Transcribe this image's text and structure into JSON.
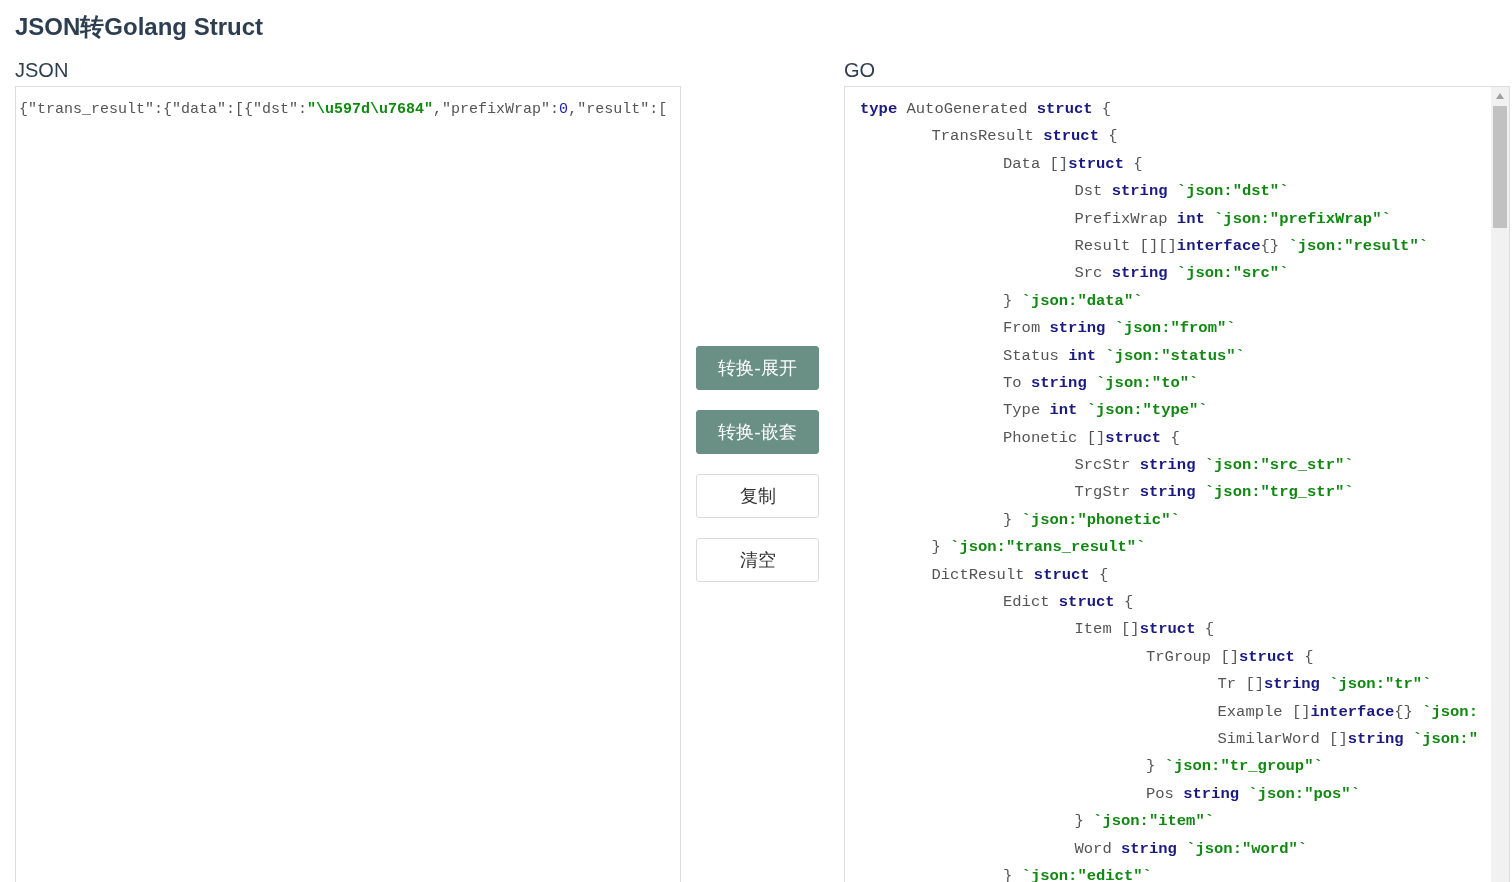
{
  "title": "JSON转Golang Struct",
  "json_panel": {
    "label": "JSON",
    "value": [
      {
        "kind": "plain",
        "text": "{\"trans_result\":{\"data\":[{\"dst\":"
      },
      {
        "kind": "string",
        "text": "\"\\u597d\\u7684\""
      },
      {
        "kind": "plain",
        "text": ",\"prefixWrap\":"
      },
      {
        "kind": "number",
        "text": "0"
      },
      {
        "kind": "plain",
        "text": ",\"result\":["
      }
    ]
  },
  "buttons": [
    {
      "label": "转换-展开",
      "kind": "primary"
    },
    {
      "label": "转换-嵌套",
      "kind": "primary"
    },
    {
      "label": "复制",
      "kind": "default"
    },
    {
      "label": "清空",
      "kind": "default"
    }
  ],
  "go_panel": {
    "label": "GO",
    "lines": [
      {
        "tokens": [
          {
            "kind": "keyword",
            "text": "type"
          },
          {
            "kind": "ident",
            "text": " AutoGenerated "
          },
          {
            "kind": "keyword",
            "text": "struct"
          },
          {
            "kind": "ident",
            "text": " {"
          }
        ],
        "children": [
          {
            "tokens": [
              {
                "kind": "ident",
                "text": "TransResult "
              },
              {
                "kind": "keyword",
                "text": "struct"
              },
              {
                "kind": "ident",
                "text": " {"
              }
            ],
            "children": [
              {
                "tokens": [
                  {
                    "kind": "ident",
                    "text": "Data []"
                  },
                  {
                    "kind": "keyword",
                    "text": "struct"
                  },
                  {
                    "kind": "ident",
                    "text": " {"
                  }
                ],
                "children": [
                  {
                    "tokens": [
                      {
                        "kind": "ident",
                        "text": "Dst "
                      },
                      {
                        "kind": "keyword",
                        "text": "string"
                      },
                      {
                        "kind": "tag",
                        "text": " `json:\"dst\"`"
                      }
                    ]
                  },
                  {
                    "tokens": [
                      {
                        "kind": "ident",
                        "text": "PrefixWrap "
                      },
                      {
                        "kind": "keyword",
                        "text": "int"
                      },
                      {
                        "kind": "tag",
                        "text": " `json:\"prefixWrap\"`"
                      }
                    ]
                  },
                  {
                    "tokens": [
                      {
                        "kind": "ident",
                        "text": "Result [][]"
                      },
                      {
                        "kind": "keyword",
                        "text": "interface"
                      },
                      {
                        "kind": "ident",
                        "text": "{}"
                      },
                      {
                        "kind": "tag",
                        "text": " `json:\"result\"`"
                      }
                    ]
                  },
                  {
                    "tokens": [
                      {
                        "kind": "ident",
                        "text": "Src "
                      },
                      {
                        "kind": "keyword",
                        "text": "string"
                      },
                      {
                        "kind": "tag",
                        "text": " `json:\"src\"`"
                      }
                    ]
                  }
                ]
              },
              {
                "tokens": [
                  {
                    "kind": "ident",
                    "text": "} "
                  },
                  {
                    "kind": "tag",
                    "text": "`json:\"data\"`"
                  }
                ]
              },
              {
                "tokens": [
                  {
                    "kind": "ident",
                    "text": "From "
                  },
                  {
                    "kind": "keyword",
                    "text": "string"
                  },
                  {
                    "kind": "tag",
                    "text": " `json:\"from\"`"
                  }
                ]
              },
              {
                "tokens": [
                  {
                    "kind": "ident",
                    "text": "Status "
                  },
                  {
                    "kind": "keyword",
                    "text": "int"
                  },
                  {
                    "kind": "tag",
                    "text": " `json:\"status\"`"
                  }
                ]
              },
              {
                "tokens": [
                  {
                    "kind": "ident",
                    "text": "To "
                  },
                  {
                    "kind": "keyword",
                    "text": "string"
                  },
                  {
                    "kind": "tag",
                    "text": " `json:\"to\"`"
                  }
                ]
              },
              {
                "tokens": [
                  {
                    "kind": "ident",
                    "text": "Type "
                  },
                  {
                    "kind": "keyword",
                    "text": "int"
                  },
                  {
                    "kind": "tag",
                    "text": " `json:\"type\"`"
                  }
                ]
              },
              {
                "tokens": [
                  {
                    "kind": "ident",
                    "text": "Phonetic []"
                  },
                  {
                    "kind": "keyword",
                    "text": "struct"
                  },
                  {
                    "kind": "ident",
                    "text": " {"
                  }
                ],
                "children": [
                  {
                    "tokens": [
                      {
                        "kind": "ident",
                        "text": "SrcStr "
                      },
                      {
                        "kind": "keyword",
                        "text": "string"
                      },
                      {
                        "kind": "tag",
                        "text": " `json:\"src_str\"`"
                      }
                    ]
                  },
                  {
                    "tokens": [
                      {
                        "kind": "ident",
                        "text": "TrgStr "
                      },
                      {
                        "kind": "keyword",
                        "text": "string"
                      },
                      {
                        "kind": "tag",
                        "text": " `json:\"trg_str\"`"
                      }
                    ]
                  }
                ]
              },
              {
                "tokens": [
                  {
                    "kind": "ident",
                    "text": "} "
                  },
                  {
                    "kind": "tag",
                    "text": "`json:\"phonetic\"`"
                  }
                ]
              }
            ]
          },
          {
            "tokens": [
              {
                "kind": "ident",
                "text": "} "
              },
              {
                "kind": "tag",
                "text": "`json:\"trans_result\"`"
              }
            ]
          },
          {
            "tokens": [
              {
                "kind": "ident",
                "text": "DictResult "
              },
              {
                "kind": "keyword",
                "text": "struct"
              },
              {
                "kind": "ident",
                "text": " {"
              }
            ],
            "children": [
              {
                "tokens": [
                  {
                    "kind": "ident",
                    "text": "Edict "
                  },
                  {
                    "kind": "keyword",
                    "text": "struct"
                  },
                  {
                    "kind": "ident",
                    "text": " {"
                  }
                ],
                "children": [
                  {
                    "tokens": [
                      {
                        "kind": "ident",
                        "text": "Item []"
                      },
                      {
                        "kind": "keyword",
                        "text": "struct"
                      },
                      {
                        "kind": "ident",
                        "text": " {"
                      }
                    ],
                    "children": [
                      {
                        "tokens": [
                          {
                            "kind": "ident",
                            "text": "TrGroup []"
                          },
                          {
                            "kind": "keyword",
                            "text": "struct"
                          },
                          {
                            "kind": "ident",
                            "text": " {"
                          }
                        ],
                        "children": [
                          {
                            "tokens": [
                              {
                                "kind": "ident",
                                "text": "Tr []"
                              },
                              {
                                "kind": "keyword",
                                "text": "string"
                              },
                              {
                                "kind": "tag",
                                "text": " `json:\"tr\"`"
                              }
                            ]
                          },
                          {
                            "tokens": [
                              {
                                "kind": "ident",
                                "text": "Example []"
                              },
                              {
                                "kind": "keyword",
                                "text": "interface"
                              },
                              {
                                "kind": "ident",
                                "text": "{}"
                              },
                              {
                                "kind": "tag",
                                "text": " `json:"
                              }
                            ]
                          },
                          {
                            "tokens": [
                              {
                                "kind": "ident",
                                "text": "SimilarWord []"
                              },
                              {
                                "kind": "keyword",
                                "text": "string"
                              },
                              {
                                "kind": "tag",
                                "text": " `json:\""
                              }
                            ]
                          }
                        ]
                      },
                      {
                        "tokens": [
                          {
                            "kind": "ident",
                            "text": "} "
                          },
                          {
                            "kind": "tag",
                            "text": "`json:\"tr_group\"`"
                          }
                        ]
                      },
                      {
                        "tokens": [
                          {
                            "kind": "ident",
                            "text": "Pos "
                          },
                          {
                            "kind": "keyword",
                            "text": "string"
                          },
                          {
                            "kind": "tag",
                            "text": " `json:\"pos\"`"
                          }
                        ]
                      }
                    ]
                  },
                  {
                    "tokens": [
                      {
                        "kind": "ident",
                        "text": "} "
                      },
                      {
                        "kind": "tag",
                        "text": "`json:\"item\"`"
                      }
                    ]
                  },
                  {
                    "tokens": [
                      {
                        "kind": "ident",
                        "text": "Word "
                      },
                      {
                        "kind": "keyword",
                        "text": "string"
                      },
                      {
                        "kind": "tag",
                        "text": " `json:\"word\"`"
                      }
                    ]
                  }
                ]
              },
              {
                "tokens": [
                  {
                    "kind": "ident",
                    "text": "} "
                  },
                  {
                    "kind": "tag",
                    "text": "`json:\"edict\"`"
                  }
                ]
              }
            ]
          }
        ]
      }
    ]
  }
}
